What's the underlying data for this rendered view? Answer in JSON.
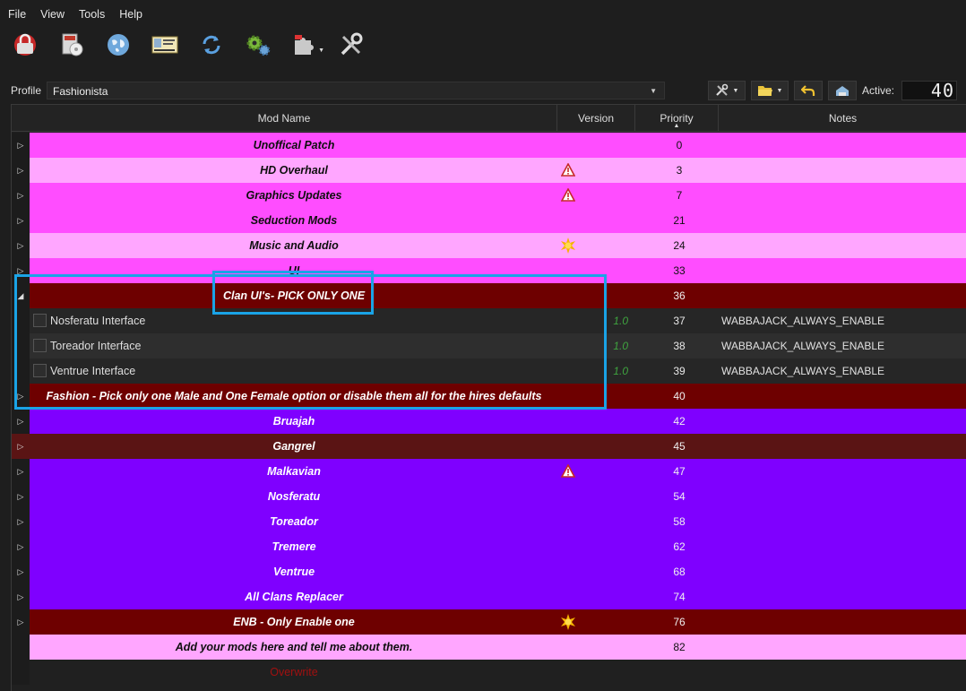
{
  "menu": [
    "File",
    "View",
    "Tools",
    "Help"
  ],
  "toolbar": [
    {
      "icon": "open-instance-icon"
    },
    {
      "icon": "install-mod-icon"
    },
    {
      "icon": "nexus-globe-icon"
    },
    {
      "icon": "profiles-card-icon"
    },
    {
      "icon": "refresh-icon"
    },
    {
      "icon": "executables-gears-icon"
    },
    {
      "icon": "plugins-puzzle-icon"
    },
    {
      "icon": "settings-tools-icon"
    }
  ],
  "profile": {
    "label": "Profile",
    "value": "Fashionista",
    "active_label": "Active:",
    "active_count": "40"
  },
  "columns": {
    "mod_name": "Mod Name",
    "version": "Version",
    "priority": "Priority",
    "notes": "Notes"
  },
  "colors": {
    "magenta": "#ff4dff",
    "pink": "#ffa6ff",
    "maroon": "#6e0000",
    "dark_maroon": "#5a1414",
    "purple": "#7f00ff",
    "highlight": "#1aa3e6",
    "version_green": "#3fa33f"
  },
  "rows": [
    {
      "type": "separator",
      "name": "Unoffical Patch",
      "priority": "0",
      "color": "#ff4dff",
      "expander": "collapsed"
    },
    {
      "type": "separator",
      "name": "HD Overhaul",
      "priority": "3",
      "color": "#ffa6ff",
      "expander": "collapsed",
      "flag": "warning-icon"
    },
    {
      "type": "separator",
      "name": "Graphics Updates",
      "priority": "7",
      "color": "#ff4dff",
      "expander": "collapsed",
      "flag": "warning-icon"
    },
    {
      "type": "separator",
      "name": "Seduction Mods",
      "priority": "21",
      "color": "#ff4dff",
      "expander": "collapsed"
    },
    {
      "type": "separator",
      "name": "Music and Audio",
      "priority": "24",
      "color": "#ffa6ff",
      "expander": "collapsed",
      "flag": "conflict-star-icon"
    },
    {
      "type": "separator",
      "name": "UI",
      "priority": "33",
      "color": "#ff4dff",
      "expander": "collapsed"
    },
    {
      "type": "separator",
      "name": "Clan UI's- PICK ONLY ONE",
      "priority": "36",
      "color": "#6e0000",
      "dark": true,
      "expander": "expanded"
    },
    {
      "type": "mod",
      "name": "Nosferatu Interface",
      "version": "1.0",
      "priority": "37",
      "notes": "WABBAJACK_ALWAYS_ENABLE"
    },
    {
      "type": "mod",
      "name": "Toreador Interface",
      "version": "1.0",
      "priority": "38",
      "notes": "WABBAJACK_ALWAYS_ENABLE"
    },
    {
      "type": "mod",
      "name": "Ventrue Interface",
      "version": "1.0",
      "priority": "39",
      "notes": "WABBAJACK_ALWAYS_ENABLE"
    },
    {
      "type": "separator",
      "name": "Fashion - Pick only one Male and One Female option or disable them all for the hires defaults",
      "priority": "40",
      "color": "#6e0000",
      "dark": true,
      "expander": "collapsed"
    },
    {
      "type": "separator",
      "name": "Bruajah",
      "priority": "42",
      "color": "#7f00ff",
      "dark": true,
      "expander": "collapsed"
    },
    {
      "type": "separator",
      "name": "Gangrel",
      "priority": "45",
      "color": "#5a1414",
      "dark": true,
      "expander": "collapsed",
      "exp_color": "#5a1414"
    },
    {
      "type": "separator",
      "name": "Malkavian",
      "priority": "47",
      "color": "#7f00ff",
      "dark": true,
      "expander": "collapsed",
      "flag": "warning-icon"
    },
    {
      "type": "separator",
      "name": "Nosferatu",
      "priority": "54",
      "color": "#7f00ff",
      "dark": true,
      "expander": "collapsed"
    },
    {
      "type": "separator",
      "name": "Toreador",
      "priority": "58",
      "color": "#7f00ff",
      "dark": true,
      "expander": "collapsed"
    },
    {
      "type": "separator",
      "name": "Tremere",
      "priority": "62",
      "color": "#7f00ff",
      "dark": true,
      "expander": "collapsed"
    },
    {
      "type": "separator",
      "name": "Ventrue",
      "priority": "68",
      "color": "#7f00ff",
      "dark": true,
      "expander": "collapsed"
    },
    {
      "type": "separator",
      "name": "All Clans Replacer",
      "priority": "74",
      "color": "#7f00ff",
      "dark": true,
      "expander": "collapsed"
    },
    {
      "type": "separator",
      "name": "ENB - Only Enable one",
      "priority": "76",
      "color": "#6e0000",
      "dark": true,
      "expander": "collapsed",
      "flag": "conflict-star-icon"
    },
    {
      "type": "separator",
      "name": "Add your mods here and tell me about them.",
      "priority": "82",
      "color": "#ffa6ff",
      "expander": "none"
    },
    {
      "type": "overwrite",
      "name": "Overwrite",
      "priority": ""
    }
  ]
}
